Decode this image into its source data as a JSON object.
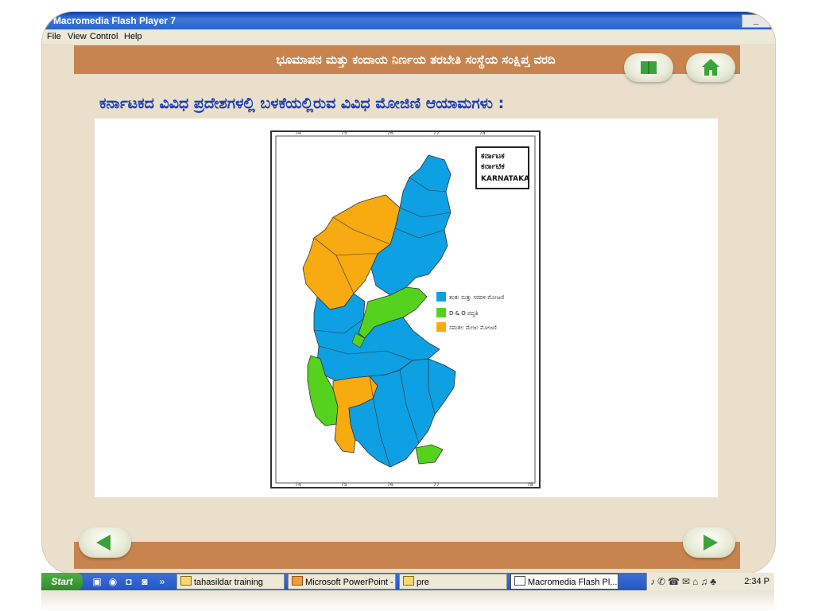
{
  "window": {
    "title": "Macromedia Flash Player 7",
    "menu": [
      "File",
      "View",
      "Control",
      "Help"
    ],
    "min_label": "_"
  },
  "header": {
    "title": "ಭೂಮಾಪನ ಮತ್ತು ಕಂದಾಯ ನಿರ್ಣಯ ತರಬೇತಿ ಸಂಸ್ಥೆಯ ಸಂಕ್ಷಿಪ್ತ ವರದಿ",
    "book_icon": "book-icon",
    "home_icon": "home-icon"
  },
  "main": {
    "heading": "ಕರ್ನಾಟಕದ ವಿವಿಧ ಪ್ರದೇಶಗಳಲ್ಲಿ ಬಳಕೆಯಲ್ಲಿರುವ ವಿವಿಧ ಮೋಜಿಣಿ ಆಯಾಮಗಳು :"
  },
  "map": {
    "title_kn": "ಕರ್ನಾಟಕ",
    "title_kn2": "ಕರ್ನಾಟಿಕ",
    "title_en": "KARNATAKA",
    "top_ticks": [
      "74",
      "75",
      "76",
      "77",
      "78"
    ],
    "bottom_ticks": [
      "74",
      "75",
      "76",
      "77",
      "78"
    ],
    "legend": [
      {
        "label": "ತಂತು ಮತ್ತು ಸರಪಳಿ ಮೋಜಣಿ",
        "color": "#0da0e3"
      },
      {
        "label": "D & O ಪದ್ಧತಿ",
        "color": "#55d21e"
      },
      {
        "label": "ಸಮತಲ ಮೇಜು ಮೋಜಣಿ",
        "color": "#f7ab10"
      }
    ]
  },
  "nav": {
    "prev_icon": "arrow-left-icon",
    "next_icon": "arrow-right-icon"
  },
  "taskbar": {
    "start_label": "Start",
    "quick_more": "»",
    "buttons": [
      {
        "label": "tahasildar training"
      },
      {
        "label": "Microsoft PowerPoint - [..."
      },
      {
        "label": "pre"
      },
      {
        "label": "Macromedia Flash Pl..."
      }
    ],
    "clock": "2:34 P"
  },
  "colors": {
    "frame": "#eadfcb",
    "bar": "#c8844e",
    "heading": "#1a3db5"
  }
}
